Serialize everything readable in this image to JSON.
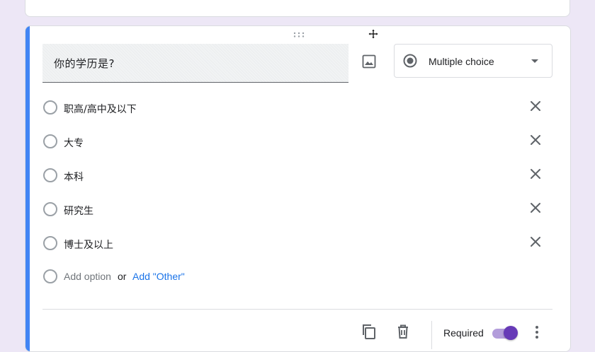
{
  "question": {
    "title": "你的学历是?",
    "type_label": "Multiple choice"
  },
  "options": [
    {
      "label": "职高/高中及以下"
    },
    {
      "label": "大专"
    },
    {
      "label": "本科"
    },
    {
      "label": "研究生"
    },
    {
      "label": "博士及以上"
    }
  ],
  "add_option": {
    "add_option_label": "Add option",
    "or_label": "or",
    "add_other_label": "Add \"Other\""
  },
  "footer": {
    "required_label": "Required",
    "required_on": true
  },
  "colors": {
    "accent_bar": "#4285f4",
    "toggle_purple": "#673ab7",
    "link_blue": "#1a73e8",
    "page_background": "#ede7f6"
  },
  "icons": {
    "drag": "drag-handle-icon",
    "image": "image-icon",
    "type_radio": "radio-button-checked-icon",
    "dropdown": "caret-down-icon",
    "remove": "close-icon",
    "duplicate": "copy-icon",
    "delete": "trash-icon",
    "more": "more-vert-icon",
    "cursor": "move-cursor-icon"
  }
}
